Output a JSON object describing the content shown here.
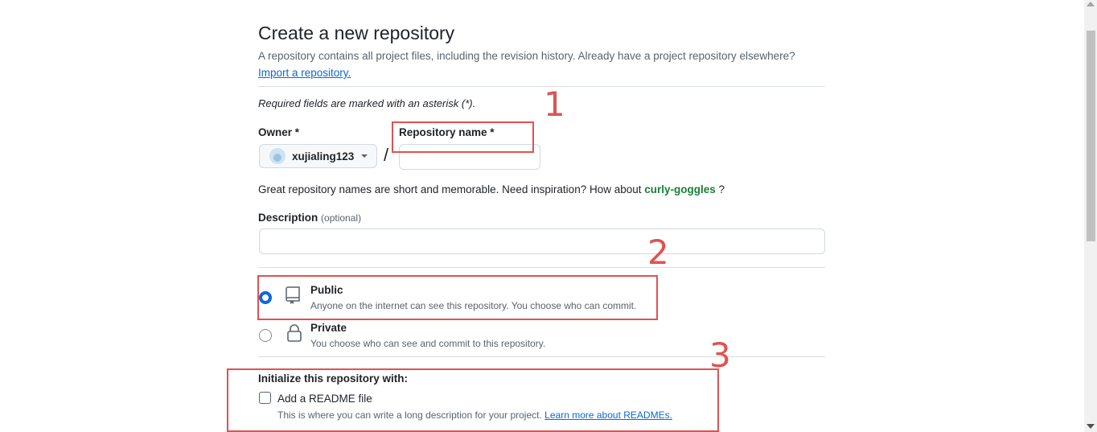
{
  "header": {
    "title": "Create a new repository",
    "subtitle": "A repository contains all project files, including the revision history. Already have a project repository elsewhere?",
    "import_link": "Import a repository."
  },
  "form": {
    "required_note": "Required fields are marked with an asterisk (*).",
    "owner": {
      "label": "Owner *",
      "value": "xujialing123"
    },
    "separator": "/",
    "repo_name": {
      "label": "Repository name *",
      "value": "",
      "placeholder": ""
    },
    "inspiration": {
      "text": "Great repository names are short and memorable. Need inspiration? How about",
      "suggestion": "curly-goggles",
      "end": "?"
    },
    "description": {
      "label": "Description",
      "optional": "(optional)",
      "value": "",
      "placeholder": ""
    },
    "visibility": {
      "selected": "public",
      "options": [
        {
          "title": "Public",
          "desc": "Anyone on the internet can see this repository. You choose who can commit.",
          "icon": "repo-icon"
        },
        {
          "title": "Private",
          "desc": "You choose who can see and commit to this repository.",
          "icon": "lock-icon"
        }
      ]
    },
    "initialize": {
      "heading": "Initialize this repository with:",
      "readme_label": "Add a README file",
      "readme_checked": false,
      "readme_desc": "This is where you can write a long description for your project.",
      "readme_link": "Learn more about READMEs."
    }
  },
  "annotations": {
    "color": "#e05252",
    "numbers": [
      "1",
      "2",
      "3"
    ]
  },
  "colors": {
    "link": "#0969da",
    "suggestion": "#1a7f37",
    "radio_selected": "#0969da"
  }
}
